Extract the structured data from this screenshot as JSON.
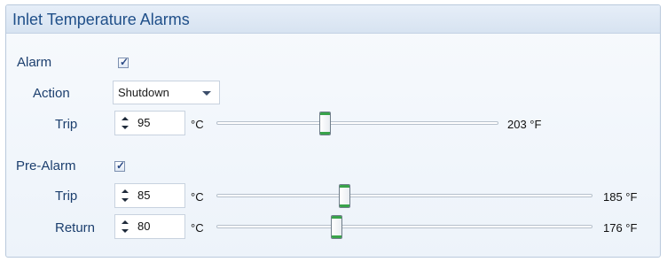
{
  "panel": {
    "title": "Inlet Temperature Alarms"
  },
  "alarm": {
    "label": "Alarm",
    "checked": true,
    "action": {
      "label": "Action",
      "value": "Shutdown"
    },
    "trip": {
      "label": "Trip",
      "celsius": "95",
      "unit": "°C",
      "fahrenheit": "203 °F",
      "slider_fraction": 0.35
    }
  },
  "pre_alarm": {
    "label": "Pre-Alarm",
    "checked": true,
    "trip": {
      "label": "Trip",
      "celsius": "85",
      "unit": "°C",
      "fahrenheit": "185 °F",
      "slider_fraction": 0.33
    },
    "return": {
      "label": "Return",
      "celsius": "80",
      "unit": "°C",
      "fahrenheit": "176 °F",
      "slider_fraction": 0.31
    }
  },
  "colors": {
    "title": "#1f4f89",
    "label": "#1c3f6e",
    "thumb_accent": "#39a34a",
    "panel_border": "#b9c9dc"
  },
  "icons": {
    "checkbox": "checkmark-icon",
    "dropdown": "chevron-down-icon",
    "spin_up": "spin-up-arrow-icon",
    "spin_down": "spin-down-arrow-icon"
  }
}
